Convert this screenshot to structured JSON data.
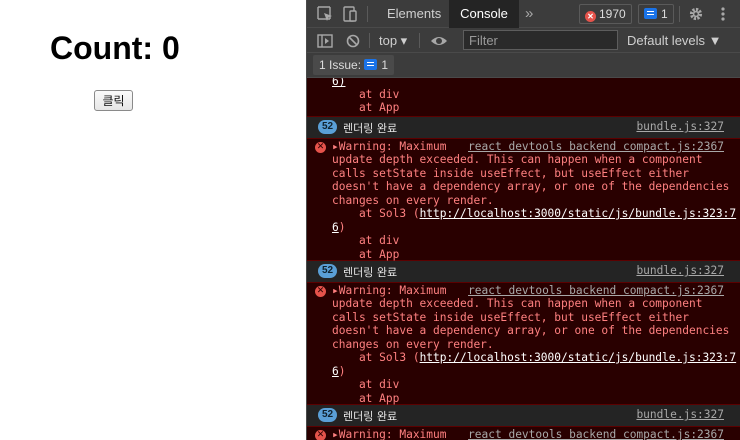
{
  "app": {
    "count_text": "Count: 0",
    "click_button_label": "클릭"
  },
  "devtools": {
    "tabs": {
      "elements": "Elements",
      "console": "Console",
      "more": "»"
    },
    "error_count": "1970",
    "message_count": "1",
    "toolbar": {
      "context": "top ▾",
      "filter_placeholder": "Filter",
      "levels": "Default levels ▼"
    },
    "issues": {
      "label": "1 Issue:",
      "count": "1"
    },
    "colors": {
      "error_bg": "#290000",
      "error_text": "#ff8080",
      "badge": "#5a9fd6"
    },
    "top_fragment": {
      "line0": "6)",
      "line1": "    at div",
      "line2": "    at App"
    },
    "log_entry": {
      "repeat_count": "52",
      "text": "렌더링 완료",
      "source": "bundle.js:327"
    },
    "warning": {
      "line1_prefix": "▸Warning: Maximum",
      "source": "react devtools backend compact.js:2367",
      "line2": "update depth exceeded. This can happen when a component",
      "line3": "calls setState inside useEffect, but useEffect either",
      "line4": "doesn't have a dependency array, or one of the dependencies",
      "line5": "changes on every render.",
      "at_sol3": "    at Sol3 (",
      "link_main": "http://localhost:3000/static/js/bundle.js:323:7",
      "link_wrap": "6",
      "close_paren": ")",
      "at_div": "    at div",
      "at_app": "    at App"
    },
    "icons": [
      "select-element-icon",
      "device-toolbar-icon",
      "settings-gear-icon",
      "kebab-menu-icon",
      "sidebar-toggle-icon",
      "clear-console-icon",
      "live-expression-eye-icon"
    ]
  }
}
